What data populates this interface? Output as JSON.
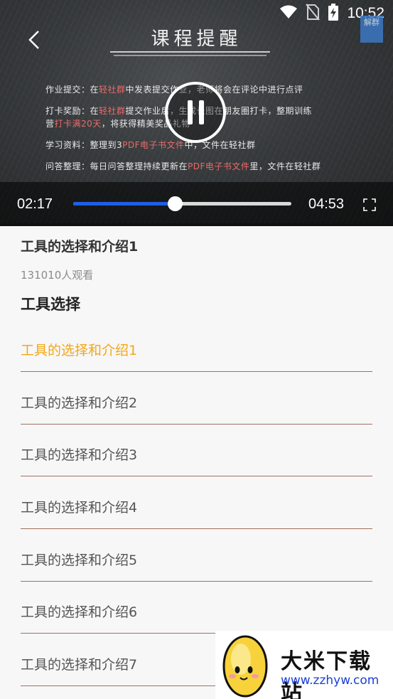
{
  "status_bar": {
    "time": "10:52",
    "icons": [
      "wifi-icon",
      "no-sim-icon",
      "battery-charging-icon"
    ]
  },
  "video": {
    "board_title": "课程提醒",
    "badge_text": "解群",
    "board_lines": [
      {
        "pre": "作业提交：在",
        "hl": "轻社群",
        "post": "中发表提交作业，老师将会在评论中进行点评"
      },
      {
        "pre": "打卡奖励：在",
        "hl": "轻社群",
        "post": "提交作业后，生成长图在朋友圈打卡，整期训练"
      },
      {
        "pre": "营",
        "hl": "打卡满20天",
        "post": "，将获得精美奖品礼物"
      },
      {
        "pre": "学习资料：整理到3",
        "hl": "PDF电子书文件",
        "post": "中，文件在轻社群"
      },
      {
        "pre": "问答整理：每日问答整理持续更新在",
        "hl": "PDF电子书文件",
        "post": "里，文件在轻社群"
      }
    ],
    "current_time": "02:17",
    "total_time": "04:53",
    "progress_fraction": 0.467,
    "colors": {
      "progress": "#1f5ee6",
      "track": "#d9d9d9"
    }
  },
  "content": {
    "video_title": "工具的选择和介绍1",
    "view_count": "131010人观看",
    "section_title": "工具选择",
    "active_color": "#f2a71b",
    "episodes": [
      {
        "label": "工具的选择和介绍1",
        "active": true
      },
      {
        "label": "工具的选择和介绍2",
        "active": false
      },
      {
        "label": "工具的选择和介绍3",
        "active": false
      },
      {
        "label": "工具的选择和介绍4",
        "active": false
      },
      {
        "label": "工具的选择和介绍5",
        "active": false
      },
      {
        "label": "工具的选择和介绍6",
        "active": false
      },
      {
        "label": "工具的选择和介绍7",
        "active": false
      }
    ]
  },
  "watermark": {
    "name": "大米下载站",
    "url": "www.zzhyw.com"
  }
}
